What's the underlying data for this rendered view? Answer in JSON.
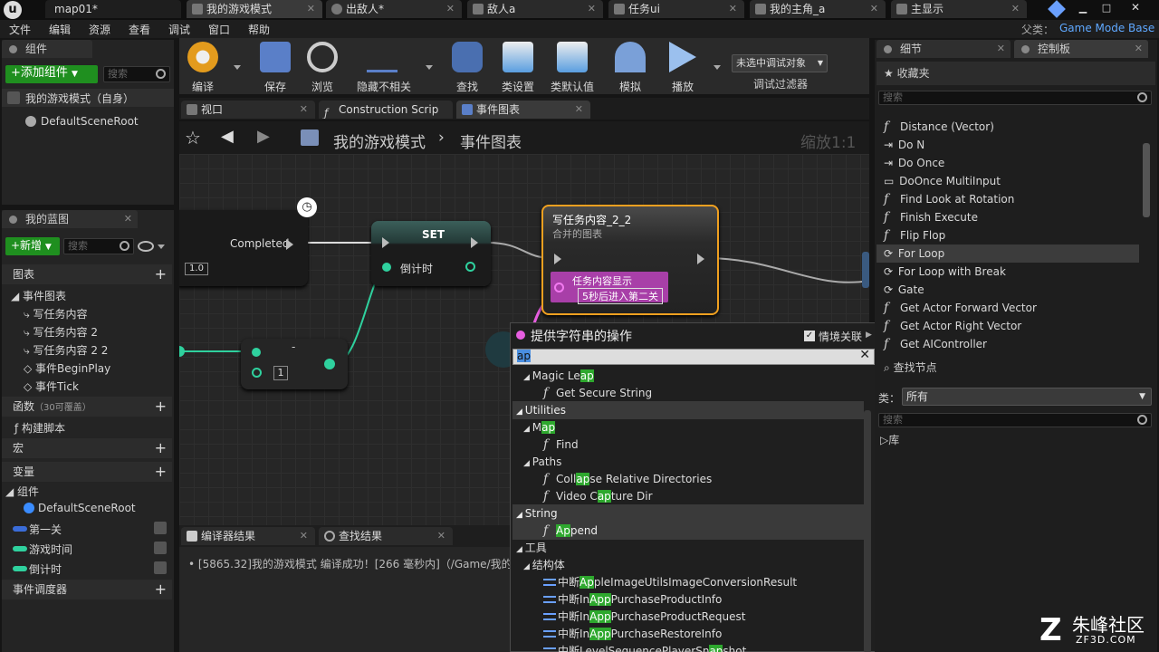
{
  "window_tabs": [
    {
      "label": "map01*"
    },
    {
      "label": "我的游戏模式"
    },
    {
      "label": "出敌人*"
    },
    {
      "label": "敌人a"
    },
    {
      "label": "任务ui"
    },
    {
      "label": "我的主角_a"
    },
    {
      "label": "主显示"
    }
  ],
  "parent_class": {
    "label": "父类：",
    "value": "Game Mode Base"
  },
  "menu": [
    "文件",
    "编辑",
    "资源",
    "查看",
    "调试",
    "窗口",
    "帮助"
  ],
  "components_panel": {
    "title": "组件",
    "add_button": "+添加组件",
    "search_placeholder": "搜索",
    "self_row": "我的游戏模式（自身）",
    "root": "DefaultSceneRoot"
  },
  "blueprint_panel": {
    "title": "我的蓝图",
    "new_button": "+新增",
    "search_placeholder": "搜索",
    "graphs_section": "图表",
    "event_graph": "事件图表",
    "graph_items": [
      "写任务内容",
      "写任务内容 2",
      "写任务内容 2 2",
      "事件BeginPlay",
      "事件Tick"
    ],
    "functions_section": "函数",
    "functions_override": "（30可覆盖）",
    "construction_script": "构建脚本",
    "macros_section": "宏",
    "variables_section": "变量",
    "components_group": "组件",
    "default_scene_root": "DefaultSceneRoot",
    "variables": [
      "第一关",
      "游戏时间",
      "倒计时"
    ],
    "dispatchers_section": "事件调度器"
  },
  "toolbar": {
    "items": [
      "编译",
      "保存",
      "浏览",
      "隐藏不相关",
      "查找",
      "类设置",
      "类默认值",
      "模拟",
      "播放"
    ],
    "debug_select": "未选中调试对象",
    "debug_filter": "调试过滤器"
  },
  "editor_tabs": [
    "视口",
    "Construction Scrip",
    "事件图表"
  ],
  "breadcrumb": {
    "root": "我的游戏模式",
    "sep": "›",
    "current": "事件图表",
    "zoom": "缩放1:1"
  },
  "graph": {
    "delay_node": {
      "completed": "Completed",
      "duration": "1.0"
    },
    "set_node": {
      "title": "SET",
      "var": "倒计时"
    },
    "int_node": {
      "value": "1"
    },
    "func_node": {
      "title": "写任务内容_2_2",
      "subtitle": "合并的图表",
      "pin_label": "任务内容显示",
      "pin_value": "5秒后进入第二关"
    }
  },
  "context_menu": {
    "title": "提供字符串的操作",
    "context_sensitive": "情境关联",
    "search_value": "ap",
    "rows": [
      {
        "type": "sub",
        "pre": "Magic Le",
        "hl": "ap",
        "post": ""
      },
      {
        "type": "fn",
        "pre": "Get Secure String",
        "hl": "",
        "post": ""
      },
      {
        "type": "cat",
        "pre": "Utilities",
        "hl": "",
        "post": ""
      },
      {
        "type": "sub",
        "pre": "M",
        "hl": "ap",
        "post": ""
      },
      {
        "type": "fn",
        "pre": "Find",
        "hl": "",
        "post": ""
      },
      {
        "type": "sub",
        "pre": "Paths",
        "hl": "",
        "post": ""
      },
      {
        "type": "fn",
        "pre": "Coll",
        "hl": "ap",
        "post": "se Relative Directories"
      },
      {
        "type": "fn",
        "pre": "Video C",
        "hl": "ap",
        "post": "ture Dir"
      },
      {
        "type": "cat",
        "pre": "String",
        "hl": "",
        "post": ""
      },
      {
        "type": "fnsel",
        "pre": "",
        "hl": "Ap",
        "post": "pend"
      },
      {
        "type": "top",
        "pre": "工具",
        "hl": "",
        "post": ""
      },
      {
        "type": "sub",
        "pre": "结构体",
        "hl": "",
        "post": ""
      },
      {
        "type": "node",
        "pre": "中断",
        "hl": "Ap",
        "post": "pleImageUtilsImageConversionResult"
      },
      {
        "type": "node",
        "pre": "中断In",
        "hl": "App",
        "post": "PurchaseProductInfo"
      },
      {
        "type": "node",
        "pre": "中断In",
        "hl": "App",
        "post": "PurchaseProductRequest"
      },
      {
        "type": "node",
        "pre": "中断In",
        "hl": "App",
        "post": "PurchaseRestoreInfo"
      },
      {
        "type": "node",
        "pre": "中断LevelSequencePlayerSn",
        "hl": "ap",
        "post": "shot"
      }
    ]
  },
  "results": {
    "tabs": [
      "编译器结果",
      "查找结果"
    ],
    "message": "[5865.32]我的游戏模式 编译成功！[266 毫秒内]（/Game/我的游"
  },
  "details": {
    "tab": "细节",
    "tab2": "控制板"
  },
  "palette": {
    "favorites": "收藏夹",
    "search_placeholder": "搜索",
    "items": [
      {
        "icon": "fn",
        "label": "Distance (Vector)"
      },
      {
        "icon": "macro",
        "label": "Do N"
      },
      {
        "icon": "macro",
        "label": "Do Once"
      },
      {
        "icon": "box",
        "label": "DoOnce MultiInput"
      },
      {
        "icon": "fn",
        "label": "Find Look at Rotation"
      },
      {
        "icon": "fn",
        "label": "Finish Execute"
      },
      {
        "icon": "fn",
        "label": "Flip Flop"
      },
      {
        "icon": "loop",
        "label": "For Loop"
      },
      {
        "icon": "loop",
        "label": "For Loop with Break"
      },
      {
        "icon": "loop",
        "label": "Gate"
      },
      {
        "icon": "fn",
        "label": "Get Actor Forward Vector"
      },
      {
        "icon": "fn",
        "label": "Get Actor Right Vector"
      },
      {
        "icon": "fn",
        "label": "Get AIController"
      }
    ],
    "find_nodes": "查找节点",
    "class_label": "类：",
    "class_value": "所有",
    "search2_placeholder": "搜索",
    "library": "库"
  },
  "watermark": {
    "brand": "朱峰社区",
    "url": "ZF3D.COM"
  }
}
